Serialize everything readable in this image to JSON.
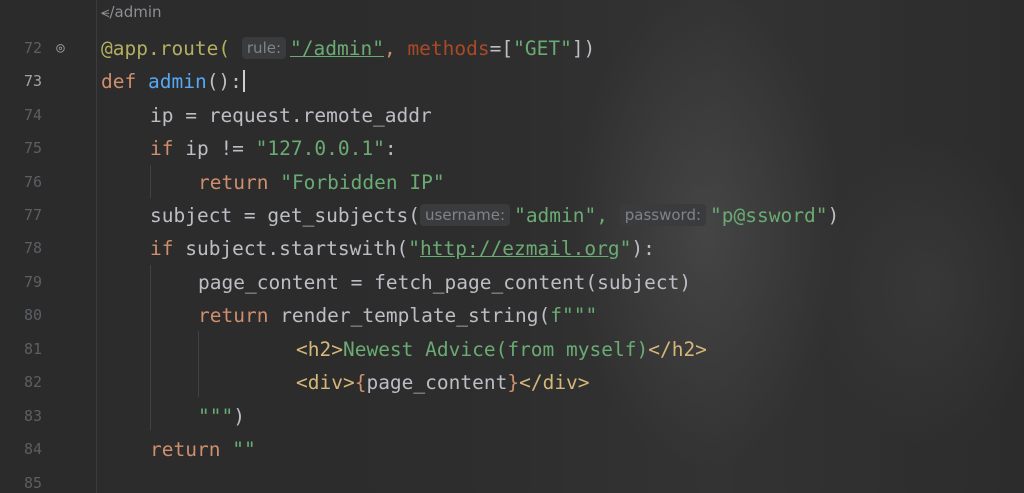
{
  "breadcrumb": {
    "icon": "share-node-icon",
    "text": "/admin"
  },
  "lines": [
    {
      "n": "72",
      "icon": "web-route-icon",
      "tokens": {
        "deco": "@app.route(",
        "hint": "rule:",
        "str1": "\"/admin\"",
        "sep": ",",
        "kw": "methods",
        "eq": "=[",
        "str2": "\"GET\"",
        "end": "])"
      }
    },
    {
      "n": "73",
      "current": true,
      "tokens": {
        "def": "def",
        "name": "admin",
        "rest": "():"
      }
    },
    {
      "n": "74",
      "tokens": {
        "text": "ip = request.remote_addr"
      }
    },
    {
      "n": "75",
      "tokens": {
        "kw": "if",
        "mid": " ip != ",
        "str": "\"127.0.0.1\"",
        "end": ":"
      }
    },
    {
      "n": "76",
      "tokens": {
        "kw": "return",
        "str": "\"Forbidden IP\""
      }
    },
    {
      "n": "77",
      "tokens": {
        "pre": "subject = get_subjects(",
        "hint1": "username:",
        "str1": "\"admin\",",
        "hint2": "password:",
        "str2": "\"p@ssword\"",
        "end": ")"
      }
    },
    {
      "n": "78",
      "tokens": {
        "kw": "if",
        "mid": " subject.startswith(",
        "q1": "\"",
        "url": "http://ezmail.org",
        "q2": "\"",
        "end": "):"
      }
    },
    {
      "n": "79",
      "tokens": {
        "text": "page_content = fetch_page_content(subject)"
      }
    },
    {
      "n": "80",
      "tokens": {
        "kw": "return",
        "mid": " render_template_string(",
        "str": "f\"\"\""
      }
    },
    {
      "n": "81",
      "tokens": {
        "t1": "<h2>",
        "txt": "Newest Advice(from myself)",
        "t2": "</h2>"
      }
    },
    {
      "n": "82",
      "tokens": {
        "t1": "<div>",
        "b1": "{",
        "var": "page_content",
        "b2": "}",
        "t2": "</div>"
      }
    },
    {
      "n": "83",
      "tokens": {
        "str": "\"\"\"",
        "end": ")"
      }
    },
    {
      "n": "84",
      "tokens": {
        "kw": "return",
        "str": "\"\""
      }
    },
    {
      "n": "85",
      "tokens": {}
    }
  ]
}
